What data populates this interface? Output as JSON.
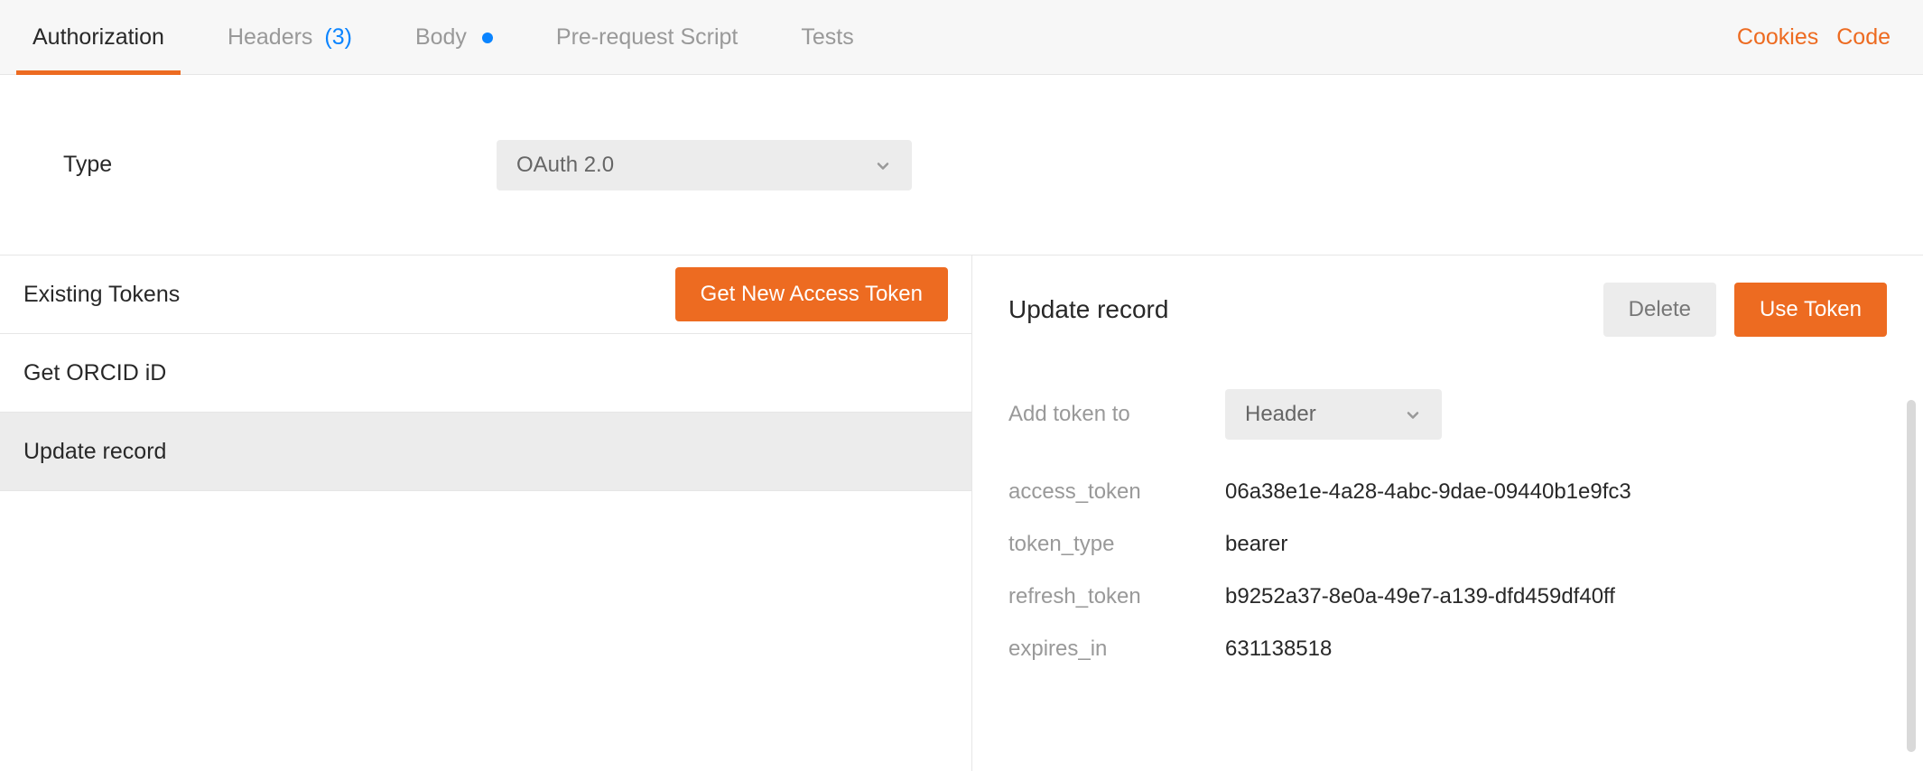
{
  "tabs": {
    "authorization": "Authorization",
    "headers_label": "Headers",
    "headers_count": "(3)",
    "body": "Body",
    "pre_request": "Pre-request Script",
    "tests": "Tests"
  },
  "right_links": {
    "cookies": "Cookies",
    "code": "Code"
  },
  "auth": {
    "type_label": "Type",
    "type_value": "OAuth 2.0"
  },
  "tokens": {
    "existing_label": "Existing Tokens",
    "get_new_button": "Get New Access Token",
    "items": [
      {
        "label": "Get ORCID iD",
        "selected": false
      },
      {
        "label": "Update record",
        "selected": true
      }
    ]
  },
  "detail": {
    "title": "Update record",
    "delete_button": "Delete",
    "use_button": "Use Token",
    "add_token_to_label": "Add token to",
    "add_token_to_value": "Header",
    "fields": [
      {
        "key": "access_token",
        "value": "06a38e1e-4a28-4abc-9dae-09440b1e9fc3"
      },
      {
        "key": "token_type",
        "value": "bearer"
      },
      {
        "key": "refresh_token",
        "value": "b9252a37-8e0a-49e7-a139-dfd459df40ff"
      },
      {
        "key": "expires_in",
        "value": "631138518"
      }
    ]
  },
  "colors": {
    "accent": "#ed6b21",
    "link_blue": "#0a84ff"
  }
}
